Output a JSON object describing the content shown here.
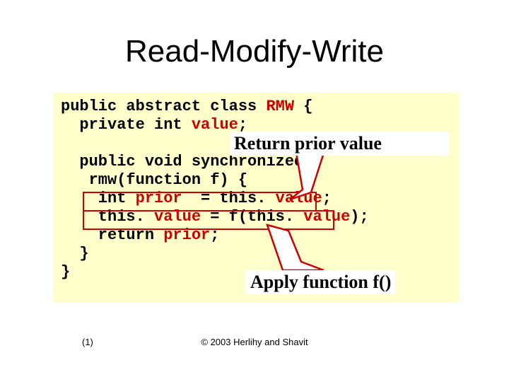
{
  "title": "Read-Modify-Write",
  "code": {
    "l1a": "public abstract class ",
    "l1b": "RMW",
    "l1c": " {",
    "l2a": "  private int ",
    "l2b": "value",
    "l2c": ";",
    "blank": "",
    "l3": "  public void synchronized",
    "l4": "   rmw(function f) {",
    "l5a": "    int ",
    "l5b": "prior",
    "l5c": "  = this.",
    "l5d": " value",
    "l5e": ";",
    "l6a": "    this.",
    "l6b": " value",
    "l6c": " = f(this.",
    "l6d": " value",
    "l6e": ");",
    "l7a": "    return ",
    "l7b": "prior",
    "l7c": ";",
    "l8": "  }",
    "l9": "}"
  },
  "callout1": "Return prior value",
  "callout2": "Apply function f()",
  "footer_left": "(1)",
  "footer_center": "© 2003 Herlihy and Shavit"
}
